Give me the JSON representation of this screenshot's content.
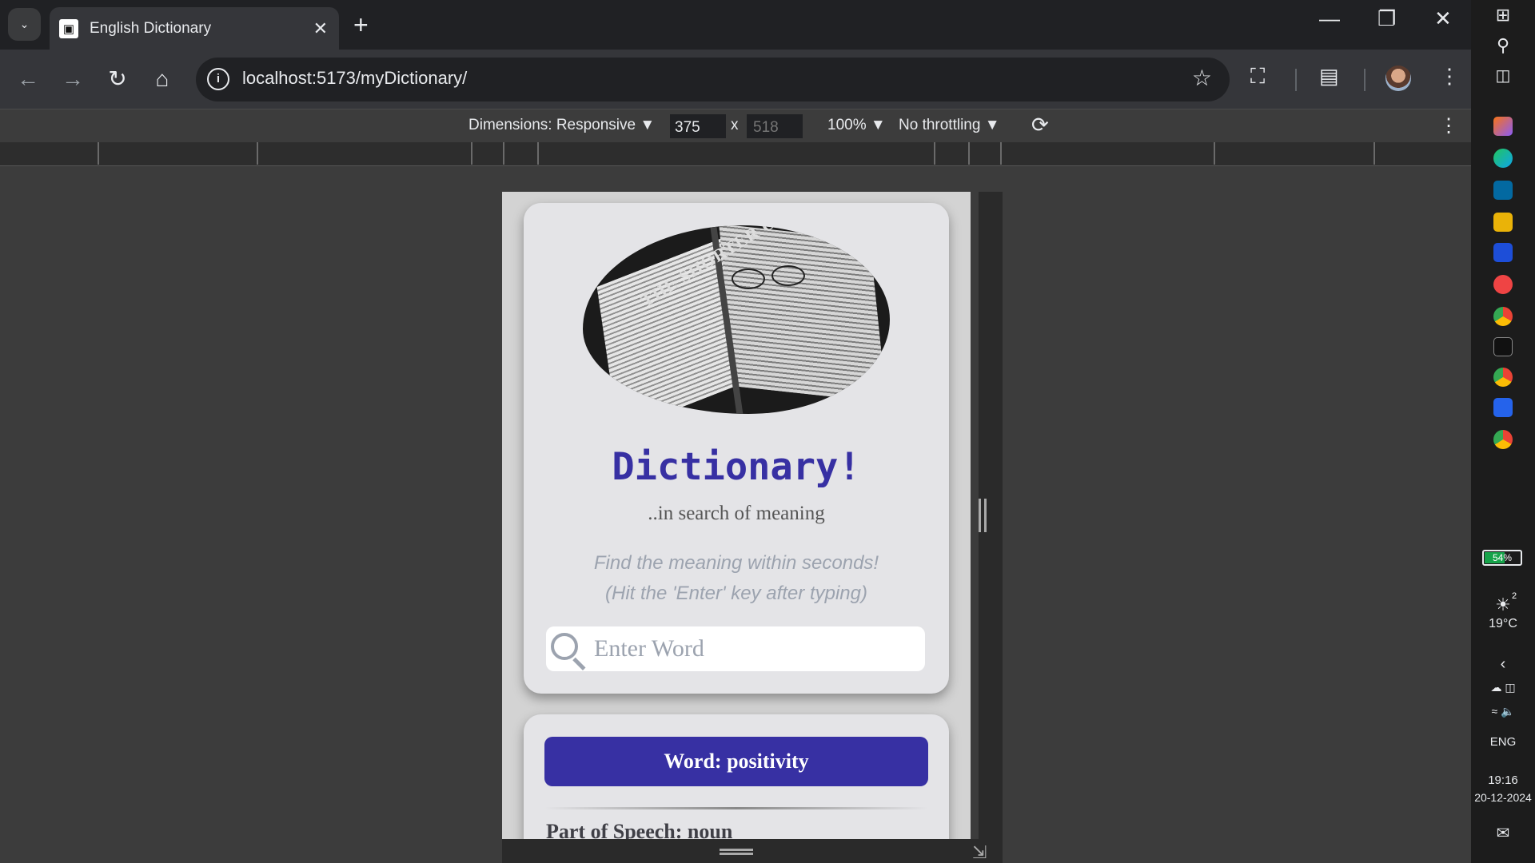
{
  "browser": {
    "tab_title": "English Dictionary",
    "url_host": "localhost",
    "url_path": ":5173/myDictionary/"
  },
  "devtools": {
    "dimensions_label": "Dimensions: Responsive",
    "width": "375",
    "size_separator": "x",
    "height_placeholder": "518",
    "zoom": "100%",
    "throttling": "No throttling"
  },
  "app": {
    "hero_text": "THE SHORTER OXFORD",
    "title": "Dictionary!",
    "subtitle": "..in search of meaning",
    "hint_line1": "Find the meaning within seconds!",
    "hint_line2": "(Hit the 'Enter' key after typing)",
    "search_placeholder": "Enter Word",
    "word_banner": "Word: positivity",
    "part_of_speech": "Part of Speech: noun"
  },
  "taskbar": {
    "battery": "54%",
    "weather_temp": "19°C",
    "weather_badge": "2",
    "language": "ENG",
    "time": "19:16",
    "date": "20-12-2024"
  },
  "colors": {
    "accent": "#3730a3",
    "card_bg": "#e4e4e7",
    "page_bg": "#d3d3d3",
    "hint": "#9ca3af"
  },
  "icons": [
    "tab-search-icon",
    "close-icon",
    "plus-icon",
    "minimize-icon",
    "restore-icon",
    "back-icon",
    "forward-icon",
    "reload-icon",
    "home-icon",
    "info-icon",
    "star-icon",
    "extensions-icon",
    "reading-list-icon",
    "more-icon",
    "rotate-icon",
    "search-icon"
  ]
}
